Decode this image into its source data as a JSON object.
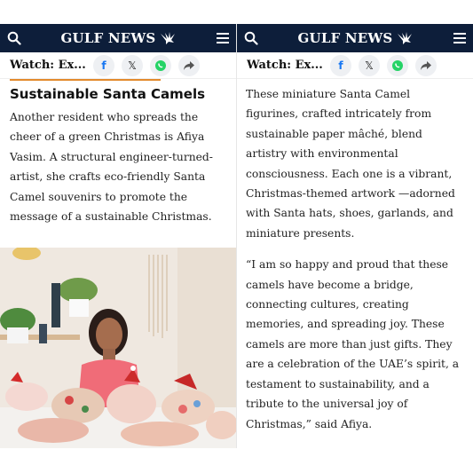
{
  "header": {
    "brand": "GULF NEWS"
  },
  "watchbar": {
    "label": "Watch: Ex..."
  },
  "share": {
    "facebook": "f",
    "x": "𝕏"
  },
  "left": {
    "section_title": "Sustainable Santa Camels",
    "paragraph": "Another resident who spreads the cheer of a green Christmas is Afiya Vasim. A structural engineer-turned-artist, she crafts eco-friendly Santa Camel souvenirs to promote the message of a sustainable Christmas."
  },
  "right": {
    "paragraph1": "These miniature Santa Camel figurines, crafted intricately from sustainable paper mâché, blend artistry with environmental consciousness. Each one is a vibrant, Christmas-themed artwork —adorned with Santa hats, shoes, garlands, and miniature presents.",
    "paragraph2": "“I am so happy and proud that these camels have become a bridge, connecting cultures, creating memories, and spreading joy. These camels are more than just gifts. They are a celebration of the UAE’s spirit, a testament to sustainability, and a tribute to the universal joy of Christmas,” said Afiya."
  },
  "colors": {
    "header_bg": "#0d1e3a",
    "accent_orange": "#e38a2d",
    "share_bg": "#eef0f3",
    "whatsapp": "#25d366"
  },
  "icons": [
    "search-icon",
    "eagle-logo-icon",
    "menu-icon",
    "facebook-icon",
    "x-icon",
    "whatsapp-icon",
    "share-arrow-icon"
  ]
}
